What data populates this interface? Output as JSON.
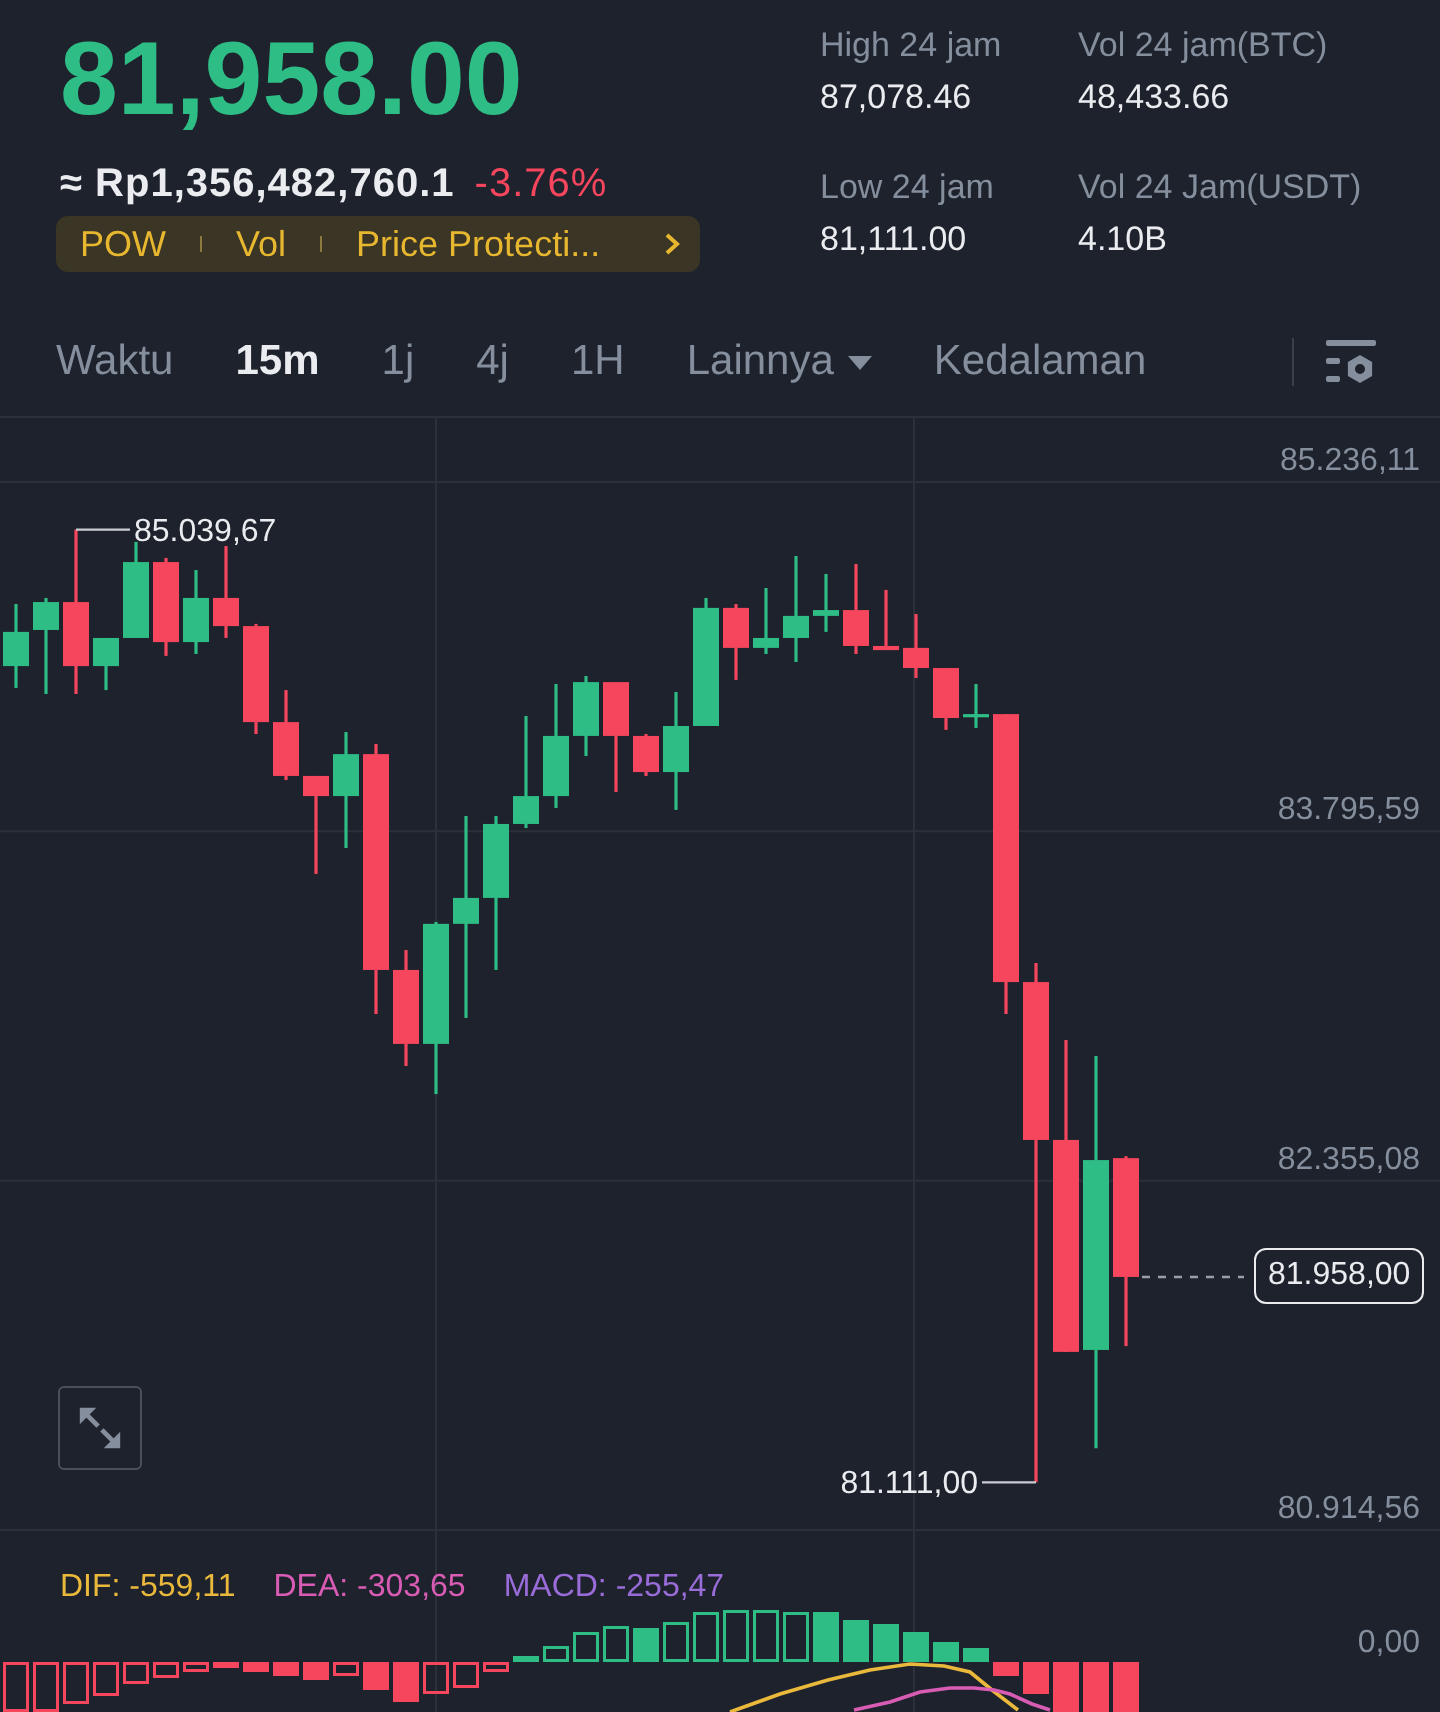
{
  "ticker": {
    "last_price": "81,958.00",
    "price_rising": true,
    "fiat_value": "≈ Rp1,356,482,760.1",
    "change": "-3.76%",
    "change_rising": false,
    "tags": [
      "POW",
      "Vol",
      "Price Protecti..."
    ]
  },
  "stats": [
    {
      "label": "High 24 jam",
      "value": "87,078.46"
    },
    {
      "label": "Vol 24 jam(BTC)",
      "value": "48,433.66"
    },
    {
      "label": "Low 24 jam",
      "value": "81,111.00"
    },
    {
      "label": "Vol 24 Jam(USDT)",
      "value": "4.10B"
    }
  ],
  "intervals": [
    {
      "label": "Waktu",
      "kind": "tab",
      "selected": false
    },
    {
      "label": "15m",
      "kind": "tab",
      "selected": true
    },
    {
      "label": "1j",
      "kind": "tab",
      "selected": false
    },
    {
      "label": "4j",
      "kind": "tab",
      "selected": false
    },
    {
      "label": "1H",
      "kind": "tab",
      "selected": false
    },
    {
      "label": "Lainnya",
      "kind": "menu",
      "selected": false
    },
    {
      "label": "Kedalaman",
      "kind": "tab",
      "selected": false
    }
  ],
  "chart": {
    "chart_data": {
      "type": "candlestick",
      "ohlc": [
        [
          84477,
          84733,
          84387,
          84618
        ],
        [
          84626,
          84758,
          84362,
          84741
        ],
        [
          84741,
          85039.67,
          84362,
          84477
        ],
        [
          84477,
          84593,
          84378,
          84593
        ],
        [
          84593,
          84989,
          84593,
          84906
        ],
        [
          84906,
          84923,
          84519,
          84576
        ],
        [
          84576,
          84873,
          84527,
          84758
        ],
        [
          84758,
          84972,
          84593,
          84642
        ],
        [
          84642,
          84651,
          84197,
          84246
        ],
        [
          84246,
          84378,
          84007,
          84024
        ],
        [
          84024,
          84024,
          83620,
          83941
        ],
        [
          83941,
          84205,
          83727,
          84114
        ],
        [
          84114,
          84156,
          83042,
          83224
        ],
        [
          83224,
          83306,
          82828,
          82919
        ],
        [
          82919,
          83422,
          82712,
          83414
        ],
        [
          83414,
          83859,
          83026,
          83521
        ],
        [
          83521,
          83859,
          83224,
          83826
        ],
        [
          83826,
          84271,
          83809,
          83941
        ],
        [
          83941,
          84403,
          83892,
          84189
        ],
        [
          84189,
          84436,
          84106,
          84411
        ],
        [
          84411,
          84411,
          83958,
          84189
        ],
        [
          84189,
          84197,
          84024,
          84040
        ],
        [
          84040,
          84370,
          83884,
          84230
        ],
        [
          84230,
          84758,
          84230,
          84717
        ],
        [
          84717,
          84733,
          84420,
          84552
        ],
        [
          84552,
          84799,
          84527,
          84593
        ],
        [
          84593,
          84931,
          84494,
          84684
        ],
        [
          84684,
          84857,
          84618,
          84708
        ],
        [
          84708,
          84898,
          84527,
          84560
        ],
        [
          84560,
          84791,
          84543,
          84543
        ],
        [
          84552,
          84692,
          84428,
          84469
        ],
        [
          84469,
          84469,
          84214,
          84263
        ],
        [
          84267,
          84403,
          84222,
          84279
        ],
        [
          84279,
          84279,
          83042,
          83174
        ],
        [
          83174,
          83253,
          81111,
          82523
        ],
        [
          82523,
          82935,
          81649,
          81649
        ],
        [
          81657,
          82869,
          81252,
          82440
        ],
        [
          82448,
          82456,
          81673,
          81958
        ]
      ],
      "grid": true,
      "ylim": [
        80914.56,
        85236.11
      ],
      "yticks": [
        {
          "value": 85236.11,
          "label": "85.236,11"
        },
        {
          "value": 83795.59,
          "label": "83.795,59"
        },
        {
          "value": 82355.08,
          "label": "82.355,08"
        },
        {
          "value": 80914.56,
          "label": "80.914,56"
        }
      ]
    },
    "high_label": "85.039,67",
    "low_label": "81.111,00",
    "last_price_tag": "81.958,00"
  },
  "macd": {
    "legend": [
      {
        "label": "DIF: -559,11",
        "color": "#eab93c"
      },
      {
        "label": "DEA: -303,65",
        "color": "#d95cb4"
      },
      {
        "label": "MACD: -255,47",
        "color": "#9a6cd9"
      }
    ],
    "axis_label": "0,00"
  }
}
